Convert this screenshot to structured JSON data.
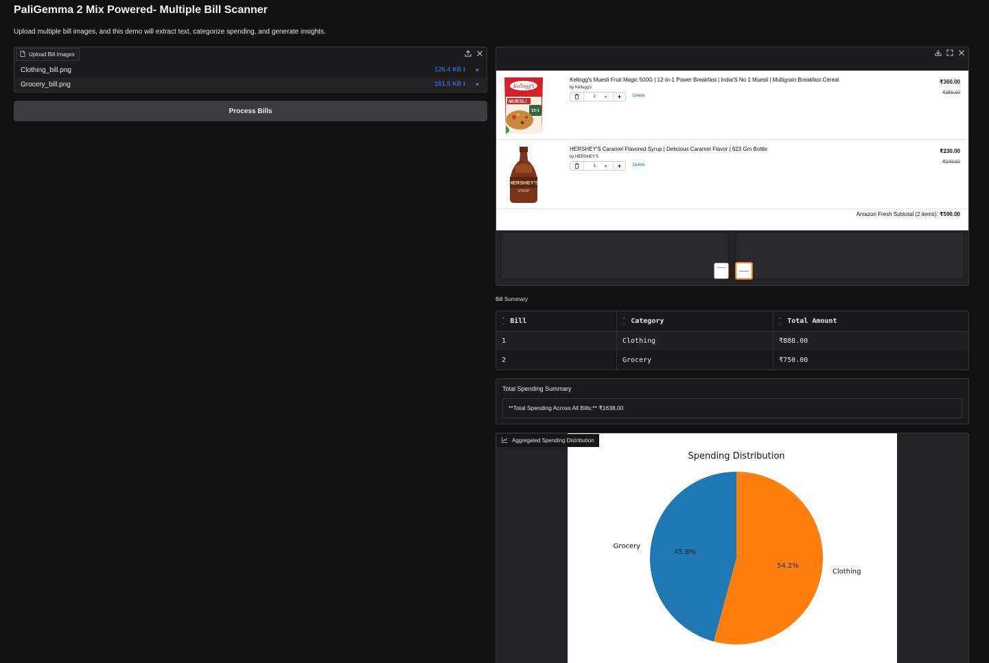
{
  "app": {
    "title": "PaliGemma 2 Mix Powered- Multiple Bill Scanner",
    "description": "Upload multiple bill images, and this demo will extract text, categorize spending, and generate insights."
  },
  "upload": {
    "tab_label": "Upload Bill Images",
    "files": [
      {
        "name": "Clothing_bill.png",
        "size": "126.4 KB ⭳"
      },
      {
        "name": "Grocery_bill.png",
        "size": "161.5 KB ⭳"
      }
    ],
    "remove_glyph": "×"
  },
  "process_button": "Process Bills",
  "gallery": {
    "products": [
      {
        "title": "Kellogg's Muesli Fruit Magic 500G | 12-In-1 Power Breakfast | India'S No 1 Muesli | Multigrain Breakfast Cereal",
        "brand": "by Kellogg's",
        "qty": "1",
        "delete": "Delete",
        "price": "₹360.00",
        "old_price": "₹385.00"
      },
      {
        "title": "HERSHEY'S Caramel Flavored Syrup | Delicious Caramel Flavor | 623 Gm Bottle",
        "brand": "by HERSHEY'S",
        "qty": "1",
        "delete": "Delete",
        "price": "₹230.00",
        "old_price": "₹240.00"
      }
    ],
    "subtotal_label": "Amazon Fresh Subtotal (2 items):",
    "subtotal_value": "₹590.00"
  },
  "bill_summary": {
    "label": "Bill Summary",
    "headers": [
      "Bill",
      "Category",
      "Total Amount"
    ],
    "rows": [
      [
        "1",
        "Clothing",
        "₹888.00"
      ],
      [
        "2",
        "Grocery",
        "₹750.00"
      ]
    ]
  },
  "total_spending": {
    "title": "Total Spending Summary",
    "text": "**Total Spending Across All Bills:** ₹1638.00"
  },
  "chart_panel": {
    "tab_label": "Aggregated Spending Distribution"
  },
  "chart_data": {
    "type": "pie",
    "title": "Spending Distribution",
    "categories": [
      "Clothing",
      "Grocery"
    ],
    "values": [
      888.0,
      750.0
    ],
    "percent_labels": [
      "54.2%",
      "45.8%"
    ],
    "colors": [
      "#ff7f0e",
      "#1f77b4"
    ],
    "legend": "none"
  }
}
